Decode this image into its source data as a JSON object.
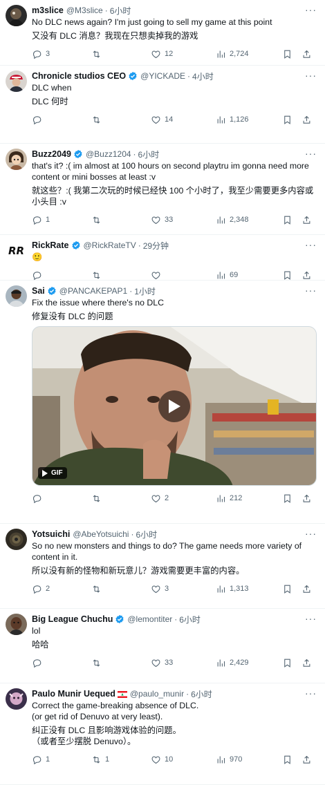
{
  "tweets": [
    {
      "name": "m3slice",
      "handle": "@M3slice",
      "time": "6小时",
      "verified": false,
      "flag": false,
      "text_en": "No DLC news again? I'm just going to sell my game at this point",
      "text_zh": "又没有 DLC 消息？我现在只想卖掉我的游戏",
      "replies": "3",
      "retweets": "",
      "likes": "12",
      "views": "2,724"
    },
    {
      "name": "Chronicle studios CEO",
      "handle": "@YICKADE",
      "time": "4小时",
      "verified": true,
      "flag": false,
      "text_en": "DLC when",
      "text_zh": "DLC 何时",
      "replies": "",
      "retweets": "",
      "likes": "14",
      "views": "1,126"
    },
    {
      "name": "Buzz2049",
      "handle": "@Buzz1204",
      "time": "6小时",
      "verified": true,
      "flag": false,
      "text_en": "that's it? :( im almost at 100 hours on second playtru im gonna need more content or mini bosses at least :v",
      "text_zh": "就这些？:( 我第二次玩的时候已经快 100 个小时了，我至少需要更多内容或小头目 :v",
      "replies": "1",
      "retweets": "",
      "likes": "33",
      "views": "2,348"
    },
    {
      "name": "RickRate",
      "handle": "@RickRateTV",
      "time": "29分钟",
      "verified": true,
      "flag": false,
      "text_en": "🙂",
      "text_zh": "",
      "replies": "",
      "retweets": "",
      "likes": "",
      "views": "69"
    },
    {
      "name": "Sai",
      "handle": "@PANCAKEPAP1",
      "time": "1小时",
      "verified": true,
      "flag": false,
      "text_en": "Fix the issue where there's no DLC",
      "text_zh": "修复没有 DLC 的问题",
      "media_badge": "GIF",
      "replies": "",
      "retweets": "",
      "likes": "2",
      "views": "212"
    },
    {
      "name": "Yotsuichi",
      "handle": "@AbeYotsuichi",
      "time": "6小时",
      "verified": false,
      "flag": false,
      "text_en": "So no new monsters and things to do? The game needs more variety of content in it.",
      "text_zh": "所以没有新的怪物和新玩意儿？游戏需要更丰富的内容。",
      "replies": "2",
      "retweets": "",
      "likes": "3",
      "views": "1,313"
    },
    {
      "name": "Big League Chuchu",
      "handle": "@lemontiter",
      "time": "6小时",
      "verified": true,
      "flag": false,
      "text_en": "lol",
      "text_zh": "哈哈",
      "replies": "",
      "retweets": "",
      "likes": "33",
      "views": "2,429"
    },
    {
      "name": "Paulo Munir Uequed",
      "handle": "@paulo_munir",
      "time": "6小时",
      "verified": false,
      "flag": true,
      "text_en": "Correct the game-breaking absence of DLC.\n(or get rid of Denuvo at very least).",
      "text_zh": "纠正没有 DLC 且影响游戏体验的问题。\n（或者至少摆脱 Denuvo）。",
      "replies": "1",
      "retweets": "1",
      "likes": "10",
      "views": "970"
    }
  ],
  "icons": [
    "reply-icon",
    "retweet-icon",
    "like-icon",
    "views-icon",
    "bookmark-icon",
    "share-icon",
    "more-icon",
    "verified-icon",
    "play-icon"
  ],
  "colors": {
    "verified": "#1d9bf0",
    "text_secondary": "#536471",
    "divider": "#eff3f4"
  }
}
